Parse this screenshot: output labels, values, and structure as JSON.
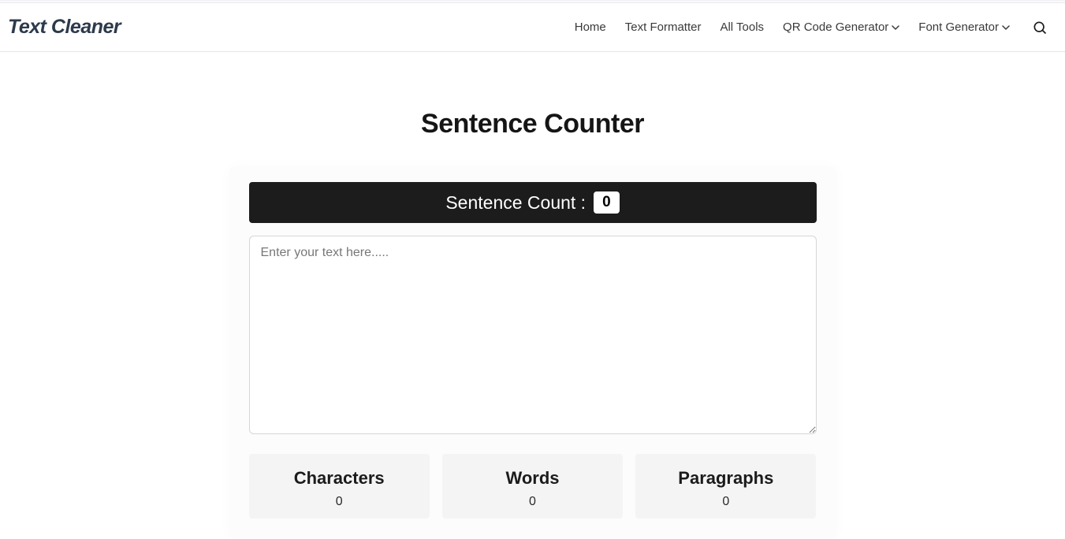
{
  "header": {
    "logo": "Text Cleaner",
    "nav": {
      "home": "Home",
      "text_formatter": "Text Formatter",
      "all_tools": "All Tools",
      "qr_code_generator": "QR Code Generator",
      "font_generator": "Font Generator"
    }
  },
  "page": {
    "title": "Sentence Counter"
  },
  "counter": {
    "label": "Sentence Count :",
    "value": "0"
  },
  "input": {
    "placeholder": "Enter your text here.....",
    "value": ""
  },
  "stats": {
    "characters": {
      "label": "Characters",
      "value": "0"
    },
    "words": {
      "label": "Words",
      "value": "0"
    },
    "paragraphs": {
      "label": "Paragraphs",
      "value": "0"
    }
  }
}
